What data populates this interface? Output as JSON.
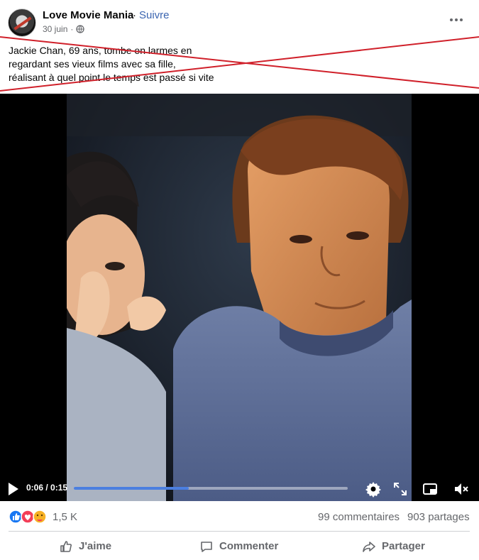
{
  "post": {
    "page_name": "Love Movie Mania",
    "separator": "·",
    "follow_label": "Suivre",
    "date": "30 juin",
    "dot": "·",
    "caption_lines": [
      "Jackie Chan, 69 ans, tombe en larmes en",
      "regardant ses vieux films avec sa fille,",
      "réalisant à quel point le temps est passé si vite"
    ]
  },
  "video": {
    "current_time": "0:06",
    "time_sep": " / ",
    "duration": "0:15",
    "progress": 0.42
  },
  "stats": {
    "reaction_count": "1,5 K",
    "comments": "99 commentaires",
    "shares": "903 partages"
  },
  "actions": {
    "like": "J'aime",
    "comment": "Commenter",
    "share": "Partager"
  },
  "icons": [
    "globe-icon",
    "more-icon",
    "play-icon",
    "settings-icon",
    "fullscreen-icon",
    "pip-icon",
    "mute-icon",
    "like-icon",
    "comment-icon",
    "share-icon"
  ],
  "colors": {
    "link": "#3b65b0",
    "progress": "#4b7fe0",
    "strike": "#d0202a",
    "muted_text": "#65676b"
  }
}
